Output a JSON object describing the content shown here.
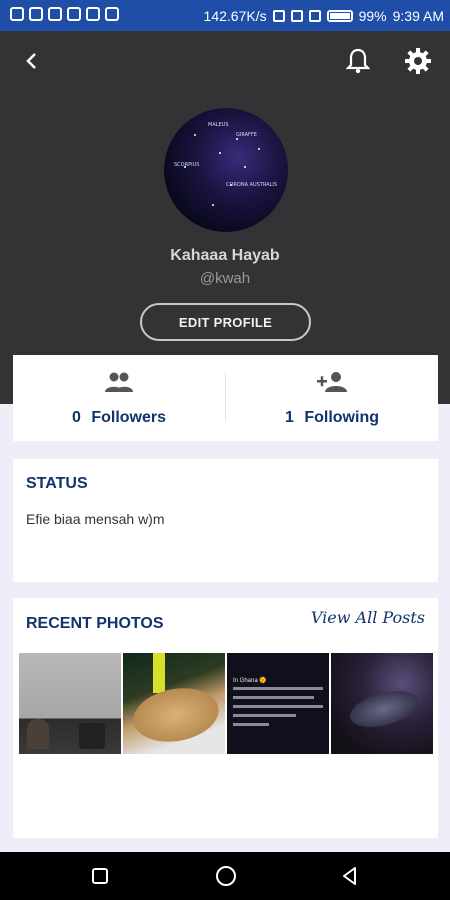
{
  "status_bar": {
    "speed": "142.67K/s",
    "battery": "99%",
    "time": "9:39 AM"
  },
  "profile": {
    "name": "Kahaaa Hayab",
    "handle": "@kwah",
    "edit_label": "EDIT PROFILE",
    "avatar_labels": [
      "SCORPIUS",
      "CORONA AUSTRALIS",
      "MALEUS",
      "GIRAFFE"
    ]
  },
  "follow": {
    "followers_count": "0",
    "followers_label": "Followers",
    "following_count": "1",
    "following_label": "Following"
  },
  "status": {
    "title": "STATUS",
    "text": "Efie biaa mensah w)m"
  },
  "photos": {
    "title": "RECENT PHOTOS",
    "view_all": "View All Posts",
    "thumb3_heading": "In Ghana 🌞"
  },
  "colors": {
    "status_bar": "#1e4ea8",
    "header": "#333335",
    "accent": "#12336b",
    "page_bg": "#eeeef8"
  },
  "icons": [
    "back-arrow-icon",
    "bell-icon",
    "gear-icon",
    "group-icon",
    "person-add-icon",
    "square-icon",
    "circle-icon",
    "triangle-back-icon"
  ]
}
